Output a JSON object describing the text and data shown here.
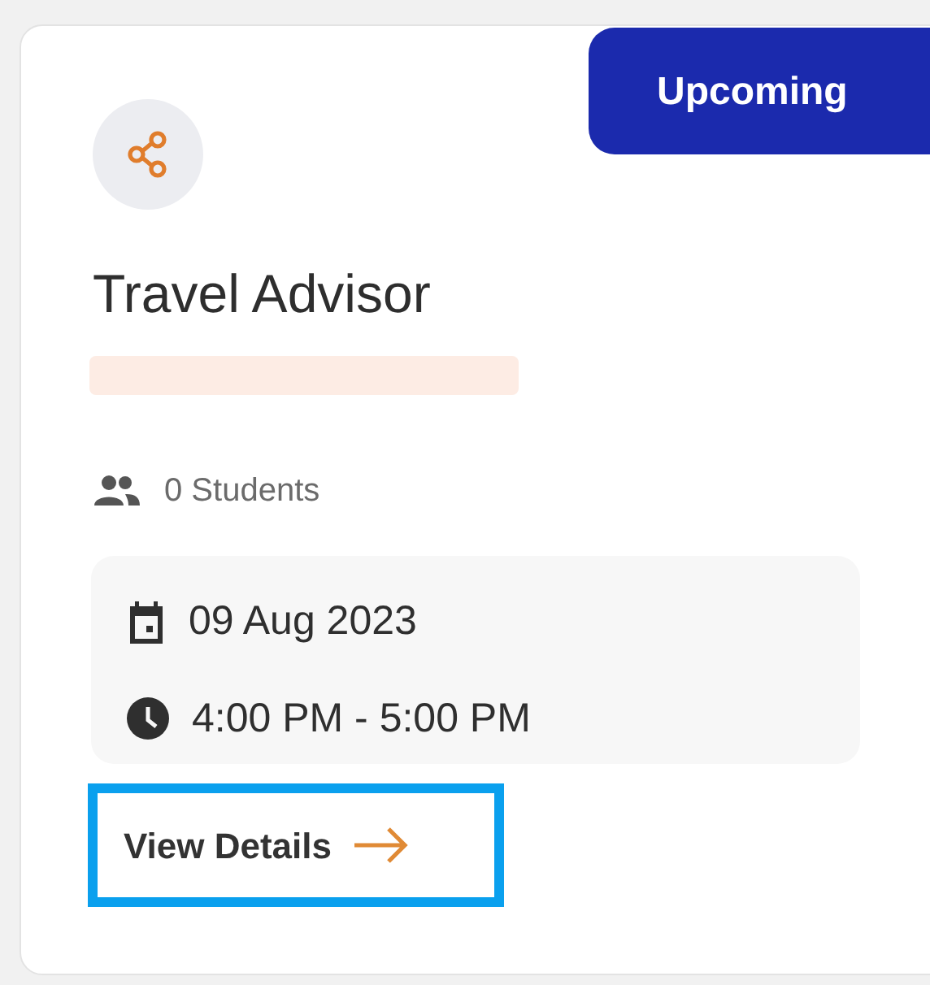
{
  "card": {
    "status_badge": "Upcoming",
    "title": "Travel Advisor",
    "students": "0 Students",
    "date": "09 Aug 2023",
    "time": "4:00 PM - 5:00 PM",
    "view_details": {
      "label": "View Details",
      "highlighted": true
    }
  }
}
